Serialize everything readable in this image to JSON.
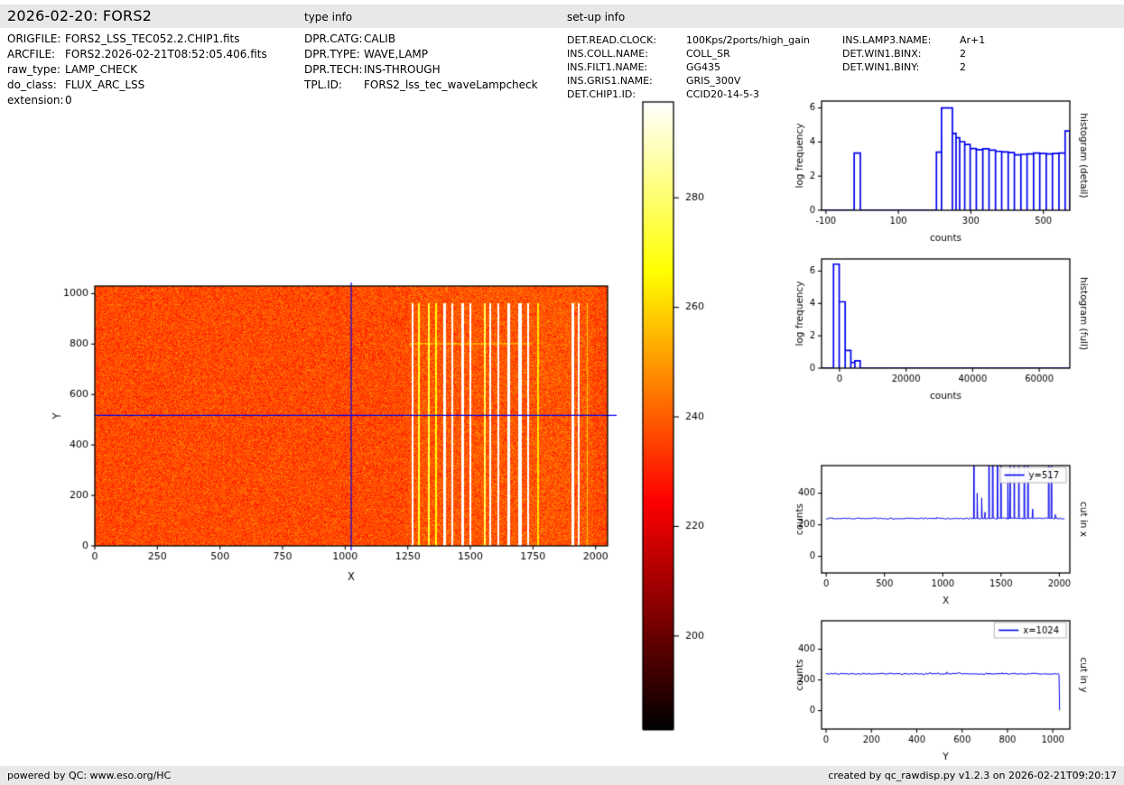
{
  "header": {
    "title": "2026-02-20: FORS2",
    "type_info_heading": "type info",
    "setup_info_heading": "set-up info"
  },
  "file_info": {
    "rows": [
      {
        "label": "ORIGFILE:",
        "value": "FORS2_LSS_TEC052.2.CHIP1.fits"
      },
      {
        "label": "ARCFILE:",
        "value": "FORS2.2026-02-21T08:52:05.406.fits"
      },
      {
        "label": "raw_type:",
        "value": "LAMP_CHECK"
      },
      {
        "label": "do_class:",
        "value": "FLUX_ARC_LSS"
      },
      {
        "label": "extension:",
        "value": "0"
      }
    ]
  },
  "type_info": {
    "rows": [
      {
        "label": "DPR.CATG:",
        "value": "CALIB"
      },
      {
        "label": "DPR.TYPE:",
        "value": "WAVE,LAMP"
      },
      {
        "label": "DPR.TECH:",
        "value": "INS-THROUGH"
      },
      {
        "label": "TPL.ID:",
        "value": "FORS2_lss_tec_waveLampcheck"
      }
    ]
  },
  "setup_info": {
    "col1": [
      {
        "label": "DET.READ.CLOCK:",
        "value": "100Kps/2ports/high_gain"
      },
      {
        "label": "INS.COLL.NAME:",
        "value": "COLL_SR"
      },
      {
        "label": "INS.FILT1.NAME:",
        "value": "GG435"
      },
      {
        "label": "INS.GRIS1.NAME:",
        "value": "GRIS_300V"
      },
      {
        "label": "DET.CHIP1.ID:",
        "value": "CCID20-14-5-3"
      }
    ],
    "col2": [
      {
        "label": "INS.LAMP3.NAME:",
        "value": "Ar+1"
      },
      {
        "label": "DET.WIN1.BINX:",
        "value": "2"
      },
      {
        "label": "DET.WIN1.BINY:",
        "value": "2"
      }
    ]
  },
  "footer": {
    "left": "powered by QC: www.eso.org/HC",
    "right": "created by qc_rawdisp.py v1.2.3 on 2026-02-21T09:20:17"
  },
  "colors": {
    "line_blue": "#0000ee",
    "panel_bg": "#e8e8e8",
    "spine": "#000000"
  },
  "chart_data": [
    {
      "id": "main-image",
      "type": "heatmap",
      "xlabel": "X",
      "ylabel": "Y",
      "xlim": [
        0,
        2048
      ],
      "ylim": [
        0,
        1030
      ],
      "xticks": [
        0,
        250,
        500,
        750,
        1000,
        1250,
        1500,
        1750,
        2000
      ],
      "yticks": [
        0,
        200,
        400,
        600,
        800,
        1000
      ],
      "colormap": "hot",
      "value_range": [
        183,
        297.5
      ],
      "background": {
        "mean": 237,
        "noise": 13
      },
      "crosshair": {
        "x": 1024,
        "y": 517
      },
      "line_top_y": 962,
      "horizontal_feature": {
        "y": 800,
        "x_start": 1258,
        "x_end": 1740,
        "boost": 13
      },
      "emission_lines": [
        {
          "x": 1269,
          "w": 10,
          "v": 310
        },
        {
          "x": 1295,
          "w": 5,
          "v": 272
        },
        {
          "x": 1334,
          "w": 5,
          "v": 274
        },
        {
          "x": 1363,
          "w": 5,
          "v": 268
        },
        {
          "x": 1396,
          "w": 11,
          "v": 310
        },
        {
          "x": 1428,
          "w": 10,
          "v": 310
        },
        {
          "x": 1471,
          "w": 11,
          "v": 310
        },
        {
          "x": 1500,
          "w": 10,
          "v": 310
        },
        {
          "x": 1558,
          "w": 5,
          "v": 278
        },
        {
          "x": 1580,
          "w": 8,
          "v": 310
        },
        {
          "x": 1612,
          "w": 10,
          "v": 310
        },
        {
          "x": 1652,
          "w": 10,
          "v": 310
        },
        {
          "x": 1699,
          "w": 13,
          "v": 312
        },
        {
          "x": 1731,
          "w": 7,
          "v": 305
        },
        {
          "x": 1771,
          "w": 5,
          "v": 262
        },
        {
          "x": 1908,
          "w": 11,
          "v": 310
        },
        {
          "x": 1933,
          "w": 9,
          "v": 310
        },
        {
          "x": 1966,
          "w": 4,
          "v": 258
        }
      ]
    },
    {
      "id": "colorbar",
      "type": "colorbar",
      "colormap": "hot",
      "vmin": 183,
      "vmax": 297.5,
      "ticks": [
        200,
        220,
        240,
        260,
        280
      ]
    },
    {
      "id": "hist-detail",
      "type": "step_histogram",
      "right_label": "histogram (detail)",
      "xlabel": "counts",
      "ylabel": "log frequency",
      "xlim": [
        -112,
        573
      ],
      "ylim": [
        0,
        6.4
      ],
      "xticks": [
        -100,
        100,
        300,
        500
      ],
      "yticks": [
        0,
        2,
        4,
        6
      ],
      "bins": [
        [
          -22,
          -5,
          3.35
        ],
        [
          205,
          219,
          3.4
        ],
        [
          219,
          249,
          6.0
        ],
        [
          249,
          259,
          4.5
        ],
        [
          259,
          269,
          4.25
        ],
        [
          269,
          283,
          4.02
        ],
        [
          283,
          298,
          3.85
        ],
        [
          298,
          315,
          3.62
        ],
        [
          315,
          333,
          3.55
        ],
        [
          333,
          350,
          3.6
        ],
        [
          350,
          368,
          3.52
        ],
        [
          368,
          385,
          3.45
        ],
        [
          385,
          403,
          3.42
        ],
        [
          403,
          420,
          3.38
        ],
        [
          420,
          438,
          3.25
        ],
        [
          438,
          455,
          3.28
        ],
        [
          455,
          473,
          3.3
        ],
        [
          473,
          490,
          3.35
        ],
        [
          490,
          508,
          3.33
        ],
        [
          508,
          525,
          3.3
        ],
        [
          525,
          543,
          3.33
        ],
        [
          543,
          560,
          3.35
        ],
        [
          560,
          573,
          4.65
        ]
      ]
    },
    {
      "id": "hist-full",
      "type": "step_histogram",
      "right_label": "histogram (full)",
      "xlabel": "counts",
      "ylabel": "log frequency",
      "xlim": [
        -5400,
        69200
      ],
      "ylim": [
        0,
        6.75
      ],
      "xticks": [
        0,
        20000,
        40000,
        60000
      ],
      "yticks": [
        0,
        2,
        4,
        6
      ],
      "bins": [
        [
          -1800,
          -100,
          6.43
        ],
        [
          -100,
          1700,
          4.1
        ],
        [
          1700,
          3400,
          1.1
        ],
        [
          3400,
          4600,
          0.35
        ],
        [
          4600,
          6200,
          0.45
        ]
      ]
    },
    {
      "id": "cut-x",
      "type": "line_cut",
      "legend": "y=517",
      "right_label": "cut in x",
      "xlabel": "X",
      "ylabel": "counts",
      "xlim": [
        -40,
        2090
      ],
      "ylim": [
        -105,
        575
      ],
      "xticks": [
        0,
        500,
        1000,
        1500,
        2000
      ],
      "yticks": [
        0,
        200,
        400
      ],
      "baseline": {
        "level": 240,
        "noise": 9,
        "x_start": 0,
        "x_end": 2048
      },
      "spikes": [
        {
          "x": 1269,
          "peak": 1500
        },
        {
          "x": 1295,
          "peak": 400
        },
        {
          "x": 1334,
          "peak": 370
        },
        {
          "x": 1363,
          "peak": 280
        },
        {
          "x": 1396,
          "peak": 1500
        },
        {
          "x": 1428,
          "peak": 1500
        },
        {
          "x": 1471,
          "peak": 1500
        },
        {
          "x": 1500,
          "peak": 1500
        },
        {
          "x": 1558,
          "peak": 520
        },
        {
          "x": 1580,
          "peak": 1500
        },
        {
          "x": 1612,
          "peak": 1500
        },
        {
          "x": 1652,
          "peak": 1500
        },
        {
          "x": 1699,
          "peak": 1500
        },
        {
          "x": 1731,
          "peak": 1500
        },
        {
          "x": 1771,
          "peak": 300
        },
        {
          "x": 1908,
          "peak": 1500
        },
        {
          "x": 1933,
          "peak": 1500
        },
        {
          "x": 1966,
          "peak": 265
        }
      ]
    },
    {
      "id": "cut-y",
      "type": "line_cut",
      "legend": "x=1024",
      "right_label": "cut in y",
      "xlabel": "Y",
      "ylabel": "counts",
      "xlim": [
        -20,
        1075
      ],
      "ylim": [
        -120,
        585
      ],
      "xticks": [
        0,
        200,
        400,
        600,
        800,
        1000
      ],
      "yticks": [
        0,
        200,
        400
      ],
      "baseline": {
        "level": 240,
        "noise": 9,
        "x_start": 0,
        "x_end": 1030
      },
      "end_drop": {
        "x": 1030,
        "value": 2
      },
      "spikes": []
    }
  ]
}
